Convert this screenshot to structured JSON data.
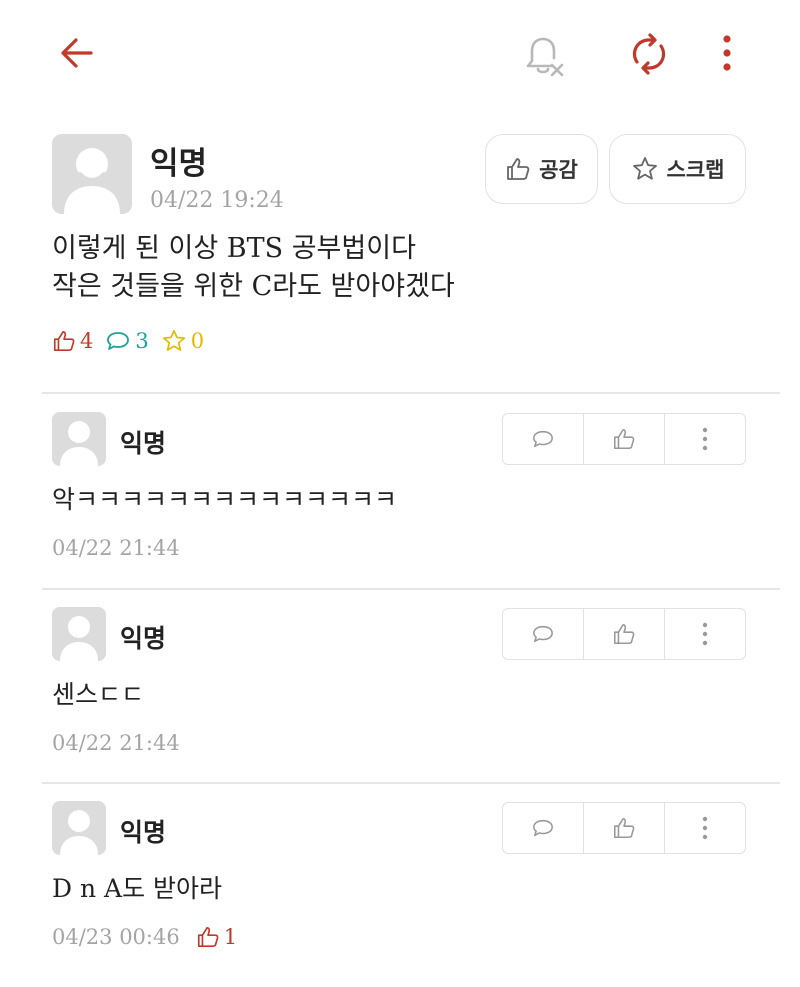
{
  "toolbar": {
    "back_icon": "arrow-left-icon",
    "notify_icon": "bell-off-icon",
    "refresh_icon": "refresh-icon",
    "more_icon": "more-vertical-icon",
    "accent_color": "#c0392b"
  },
  "post": {
    "author": "익명",
    "time": "04/22 19:24",
    "like_button_label": "공감",
    "scrap_button_label": "스크랩",
    "body_line1": "이렇게 된 이상 BTS 공부법이다",
    "body_line2": "작은 것들을 위한 C라도 받아야겠다",
    "likes": "4",
    "comments": "3",
    "scraps": "0",
    "like_color": "#c0392b",
    "comment_color": "#1aa39a",
    "scrap_color": "#e3b900"
  },
  "comments": [
    {
      "author": "익명",
      "text": "악ㅋㅋㅋㅋㅋㅋㅋㅋㅋㅋㅋㅋㅋㅋ",
      "time": "04/22 21:44",
      "likes": ""
    },
    {
      "author": "익명",
      "text": "센스ㄷㄷ",
      "time": "04/22 21:44",
      "likes": ""
    },
    {
      "author": "익명",
      "text": "D n A도 받아라",
      "time": "04/23 00:46",
      "likes": "1"
    }
  ]
}
